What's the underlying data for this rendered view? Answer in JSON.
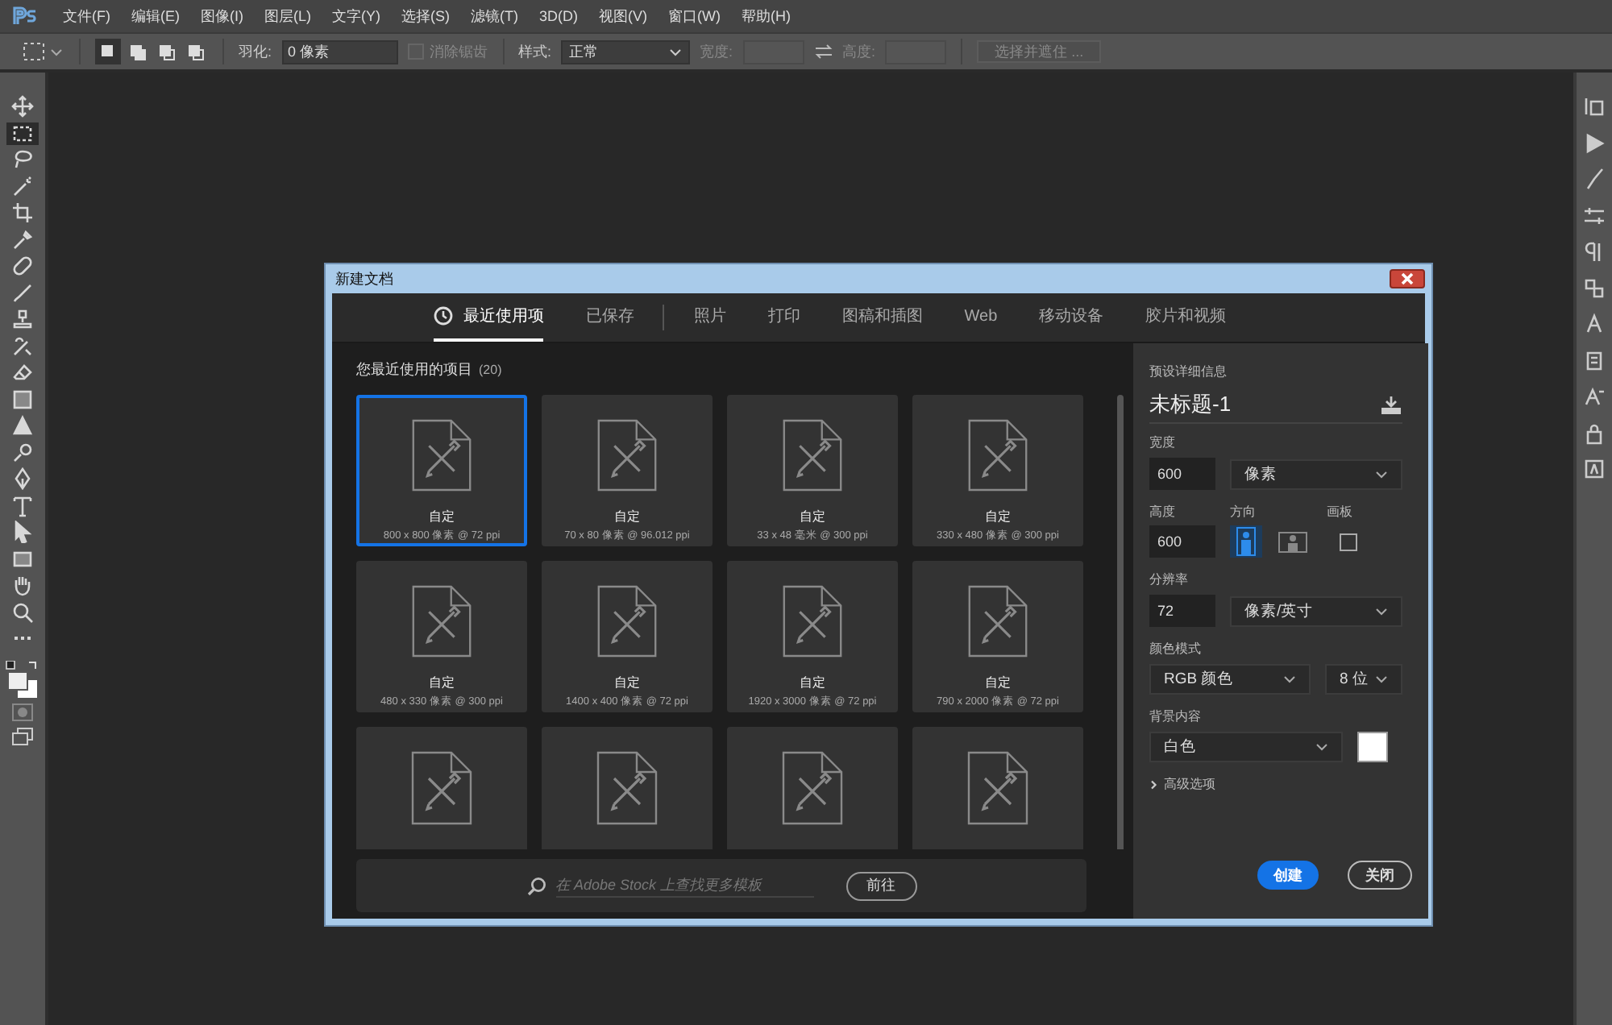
{
  "menu_bar": {
    "items": [
      "文件(F)",
      "编辑(E)",
      "图像(I)",
      "图层(L)",
      "文字(Y)",
      "选择(S)",
      "滤镜(T)",
      "3D(D)",
      "视图(V)",
      "窗口(W)",
      "帮助(H)"
    ]
  },
  "options_bar": {
    "selection_modes": [
      {
        "selected": true
      },
      {
        "selected": false
      },
      {
        "selected": false
      },
      {
        "selected": false
      }
    ],
    "feather": {
      "label": "羽化:",
      "value": "0 像素"
    },
    "anti_alias": {
      "label": "消除锯齿",
      "checked": false,
      "disabled": true
    },
    "style": {
      "label": "样式:",
      "value": "正常"
    },
    "width": {
      "label": "宽度:",
      "disabled": true
    },
    "height": {
      "label": "高度:",
      "disabled": true
    },
    "select_and_mask": {
      "label": "选择并遮住 ...",
      "disabled": true
    }
  },
  "toolbar": {
    "tools": [
      {
        "selected": false
      },
      {
        "selected": true
      },
      {
        "selected": false
      },
      {
        "selected": false
      },
      {
        "selected": false
      },
      {
        "selected": false
      },
      {
        "selected": false
      },
      {
        "selected": false
      },
      {
        "selected": false
      },
      {
        "selected": false
      },
      {
        "selected": false
      },
      {
        "selected": false
      },
      {
        "selected": false
      },
      {
        "selected": false
      },
      {
        "selected": false
      },
      {
        "selected": false
      },
      {
        "selected": false
      },
      {
        "selected": false
      },
      {
        "selected": false
      },
      {
        "selected": false
      },
      {
        "selected": false
      }
    ]
  },
  "dialog": {
    "title": "新建文档",
    "tabs": [
      {
        "label": "最近使用项",
        "selected": true
      },
      {
        "label": "已保存",
        "selected": false
      },
      {
        "label": "照片",
        "selected": false
      },
      {
        "label": "打印",
        "selected": false
      },
      {
        "label": "图稿和插图",
        "selected": false
      },
      {
        "label": "Web",
        "selected": false
      },
      {
        "label": "移动设备",
        "selected": false
      },
      {
        "label": "胶片和视频",
        "selected": false
      }
    ],
    "recent": {
      "heading": "您最近使用的项目",
      "count": "(20)",
      "items": [
        {
          "name": "自定",
          "size": "800 x 800 像素 @ 72 ppi",
          "selected": true
        },
        {
          "name": "自定",
          "size": "70 x 80 像素 @ 96.012 ppi",
          "selected": false
        },
        {
          "name": "自定",
          "size": "33 x 48 毫米 @ 300 ppi",
          "selected": false
        },
        {
          "name": "自定",
          "size": "330 x 480 像素 @ 300 ppi",
          "selected": false
        },
        {
          "name": "自定",
          "size": "480 x 330 像素 @ 300 ppi",
          "selected": false
        },
        {
          "name": "自定",
          "size": "1400 x 400 像素 @ 72 ppi",
          "selected": false
        },
        {
          "name": "自定",
          "size": "1920 x 3000 像素 @ 72 ppi",
          "selected": false
        },
        {
          "name": "自定",
          "size": "790 x 2000 像素 @ 72 ppi",
          "selected": false
        },
        {
          "selected": false
        },
        {
          "selected": false
        },
        {
          "selected": false
        },
        {
          "selected": false
        }
      ]
    },
    "stock_search": {
      "placeholder": "在 Adobe Stock 上查找更多模板",
      "button": "前往"
    },
    "preset": {
      "heading": "预设详细信息",
      "name": "未标题-1",
      "width": {
        "label": "宽度",
        "value": "600",
        "unit": "像素"
      },
      "height": {
        "label": "高度",
        "value": "600"
      },
      "orientation": {
        "label": "方向",
        "options": [
          {
            "kind": "portrait",
            "selected": true
          },
          {
            "kind": "landscape",
            "selected": false
          }
        ]
      },
      "artboard": {
        "label": "画板",
        "checked": false
      },
      "resolution": {
        "label": "分辨率",
        "value": "72",
        "unit": "像素/英寸"
      },
      "color_mode": {
        "label": "颜色模式",
        "mode": "RGB 颜色",
        "depth": "8 位"
      },
      "background": {
        "label": "背景内容",
        "value": "白色",
        "color": "#ffffff"
      },
      "advanced": {
        "label": "高级选项",
        "expanded": false
      }
    },
    "buttons": [
      {
        "label": "创建",
        "kind": "primary"
      },
      {
        "label": "关闭",
        "kind": "secondary"
      }
    ]
  }
}
